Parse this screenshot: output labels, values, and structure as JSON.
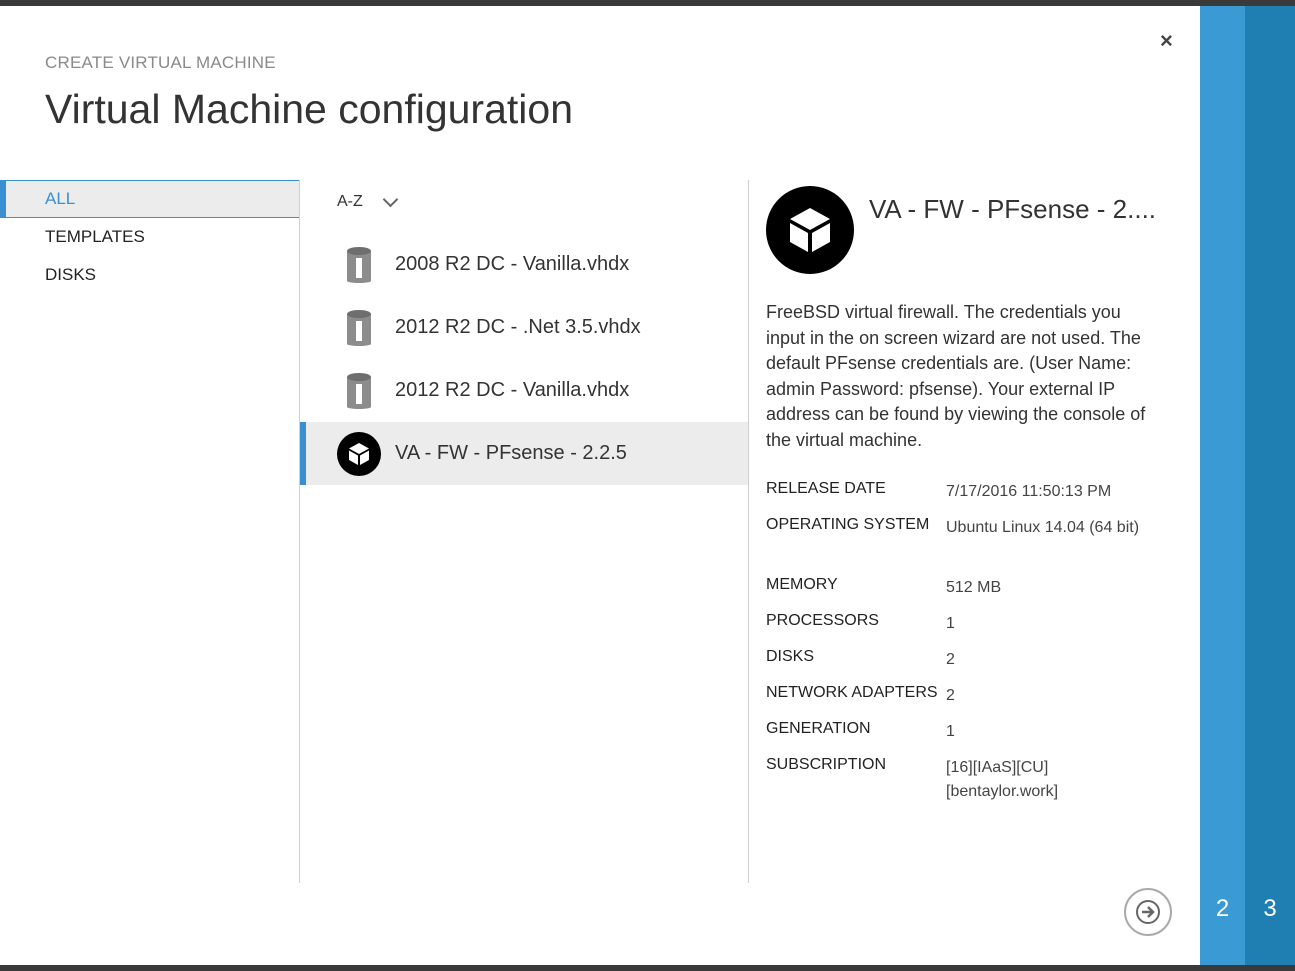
{
  "dialog": {
    "kicker": "CREATE VIRTUAL MACHINE",
    "title": "Virtual Machine configuration",
    "close_label": "×"
  },
  "nav": {
    "items": [
      {
        "label": "ALL",
        "active": true
      },
      {
        "label": "TEMPLATES",
        "active": false
      },
      {
        "label": "DISKS",
        "active": false
      }
    ]
  },
  "sort": {
    "label": "A-Z"
  },
  "list": {
    "items": [
      {
        "name": "2008 R2 DC - Vanilla.vhdx",
        "icon": "disk-icon"
      },
      {
        "name": "2012 R2 DC - .Net 3.5.vhdx",
        "icon": "disk-icon"
      },
      {
        "name": "2012 R2 DC - Vanilla.vhdx",
        "icon": "disk-icon"
      },
      {
        "name": "VA - FW - PFsense - 2.2.5",
        "icon": "package-icon",
        "selected": true
      }
    ]
  },
  "detail": {
    "title": "VA - FW - PFsense - 2....",
    "description": "FreeBSD virtual firewall. The credentials you input in the on screen wizard are not used. The default PFsense credentials are. (User Name: admin Password: pfsense). Your external IP address can be found by viewing the console of the virtual machine.",
    "properties": [
      {
        "key": "RELEASE DATE",
        "value": "7/17/2016 11:50:13 PM"
      },
      {
        "key": "OPERATING SYSTEM",
        "value": "Ubuntu Linux 14.04 (64 bit)"
      },
      {
        "key": "MEMORY",
        "value": "512 MB"
      },
      {
        "key": "PROCESSORS",
        "value": "1"
      },
      {
        "key": "DISKS",
        "value": "2"
      },
      {
        "key": "NETWORK ADAPTERS",
        "value": "2"
      },
      {
        "key": "GENERATION",
        "value": "1"
      },
      {
        "key": "SUBSCRIPTION",
        "value": "[16][IAaS][CU] [bentaylor.work]"
      }
    ]
  },
  "steps": [
    {
      "label": "2"
    },
    {
      "label": "3"
    }
  ],
  "colors": {
    "accent": "#3a8fd0",
    "step2": "#3a9bd4",
    "step3": "#1f7fb3"
  }
}
